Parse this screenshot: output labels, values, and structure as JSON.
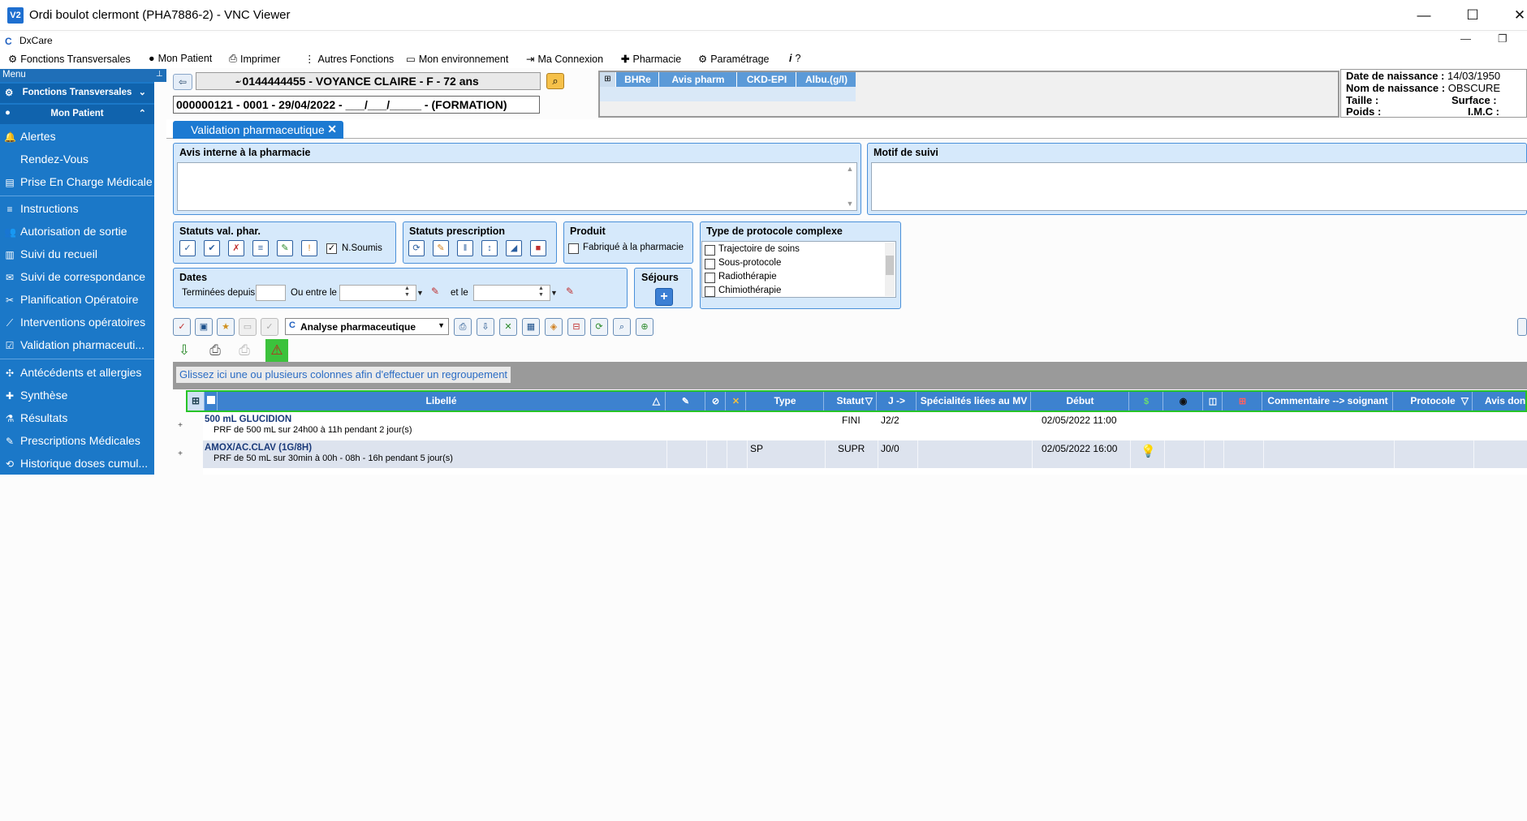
{
  "vnc": {
    "title": "Ordi boulot clermont (PHA7886-2) - VNC Viewer",
    "logo": "V2"
  },
  "app": {
    "title": "DxCare",
    "logo": "C"
  },
  "menu": [
    {
      "icon": "transversal-icon",
      "label": "Fonctions Transversales"
    },
    {
      "icon": "person-icon",
      "label": "Mon Patient"
    },
    {
      "icon": "printer-icon",
      "label": "Imprimer"
    },
    {
      "icon": "more-vertical-icon",
      "label": "Autres Fonctions"
    },
    {
      "icon": "monitor-icon",
      "label": "Mon environnement"
    },
    {
      "icon": "login-icon",
      "label": "Ma Connexion"
    },
    {
      "icon": "plus-icon",
      "label": "Pharmacie"
    },
    {
      "icon": "gear-icon",
      "label": "Paramétrage"
    },
    {
      "icon": "info-icon",
      "label": "?"
    }
  ],
  "sidebar": {
    "header": "Menu",
    "sections": [
      {
        "label": "Fonctions Transversales"
      },
      {
        "label": "Mon Patient"
      }
    ],
    "items": [
      "Alertes",
      "Rendez-Vous",
      "Prise En Charge Médicale",
      "Instructions",
      "Autorisation de sortie",
      "Suivi du recueil",
      "Suivi de correspondance",
      "Planification Opératoire",
      "Interventions opératoires",
      "Validation  pharmaceuti...",
      "Antécédents et allergies",
      "Synthèse",
      "Résultats",
      "Prescriptions Médicales",
      "Historique  doses  cumul..."
    ]
  },
  "patient": {
    "combo": "- 0144444455 - VOYANCE CLAIRE - F - 72 ans",
    "sejour": "000000121 - 0001 - 29/04/2022 - ___/___/_____ - (FORMATION)",
    "labs": [
      "BHRe",
      "Avis pharm",
      "CKD-EPI",
      "Albu.(g/l)"
    ],
    "info": {
      "dob_label": "Date de naissance :",
      "dob": "14/03/1950",
      "birthname_label": "Nom de naissance :",
      "birthname": "OBSCURE",
      "height_label": "Taille :",
      "surface_label": "Surface :",
      "weight_label": "Poids :",
      "imc_label": "I.M.C :"
    }
  },
  "tab": {
    "label": "Validation pharmaceutique",
    "close": "✕"
  },
  "form": {
    "avis_label": "Avis interne à la pharmacie",
    "motif_label": "Motif de suivi",
    "statuts_val_label": "Statuts val. phar.",
    "nsoumis_label": "N.Soumis",
    "statuts_presc_label": "Statuts prescription",
    "produit_label": "Produit",
    "fabrique_label": "Fabriqué à la pharmacie",
    "protocole_label": "Type de protocole complexe",
    "protocole_options": [
      "Trajectoire de soins",
      "Sous-protocole",
      "Radiothérapie",
      "Chimiothérapie"
    ],
    "dates_label": "Dates",
    "terminees_label": "Terminées depuis",
    "ou_entre_label": "Ou entre le",
    "et_le_label": "et le",
    "sejours_label": "Séjours"
  },
  "toolbar": {
    "analysis_combo": "Analyse pharmaceutique"
  },
  "group_hint": "Glissez ici une ou plusieurs colonnes afin d'effectuer un regroupement",
  "grid": {
    "headers": {
      "libelle": "Libellé",
      "type": "Type",
      "statut": "Statut",
      "j": "J ->",
      "specialites": "Spécialités liées au MV",
      "debut": "Début",
      "commentaire": "Commentaire --> soignant",
      "protocole": "Protocole",
      "avis": "Avis donn"
    },
    "rows": [
      {
        "name": "500 mL GLUCIDION",
        "detail": "PRF de 500 mL sur 24h00 à 11h pendant 2 jour(s)",
        "type": "",
        "statut": "FINI",
        "j": "J2/2",
        "debut": "02/05/2022 11:00"
      },
      {
        "name": "AMOX/AC.CLAV (1G/8H)",
        "detail": "PRF de 50 mL sur 30min à 00h - 08h - 16h pendant 5 jour(s)",
        "type": "SP",
        "statut": "SUPR",
        "j": "J0/0",
        "debut": "02/05/2022 16:00"
      }
    ]
  },
  "colors": {
    "sidebar": "#1b78c8",
    "grid_header": "#3d82cf",
    "grid_border": "#27c427",
    "tab": "#1c7ad2"
  }
}
